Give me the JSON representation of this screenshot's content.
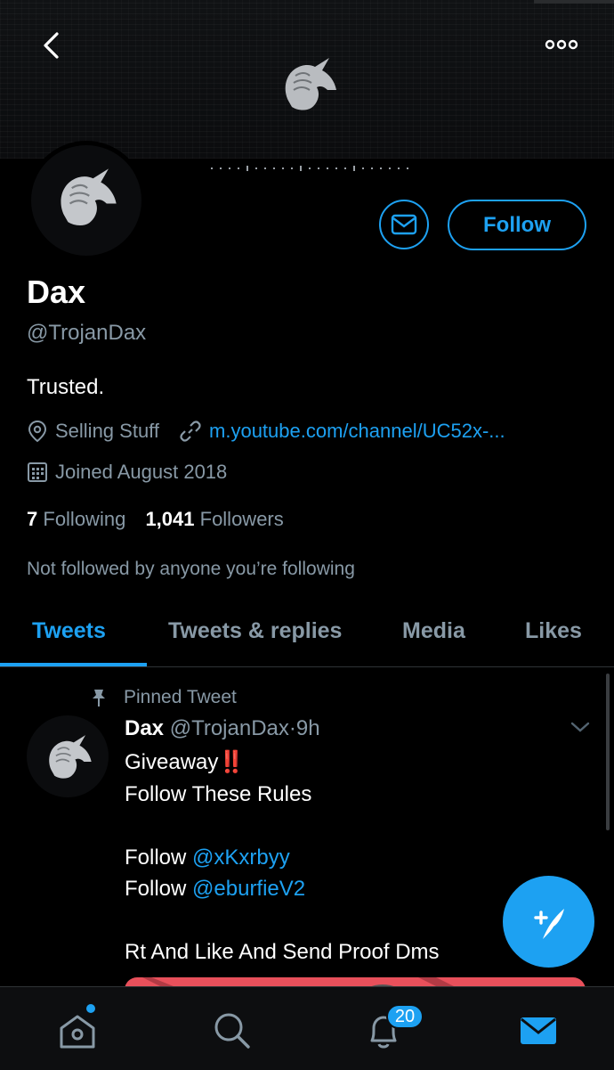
{
  "colors": {
    "accent": "#1da1f2",
    "muted": "#8899a6",
    "background": "#000000",
    "emphasis": "#e0245e"
  },
  "profile": {
    "name": "Dax",
    "handle": "@TrojanDax",
    "bio": "Trusted.",
    "location": "Selling Stuff",
    "website": "m.youtube.com/channel/UC52x-...",
    "joined": "Joined August 2018",
    "following_count": "7",
    "following_label": "Following",
    "followers_count": "1,041",
    "followers_label": "Followers",
    "not_followed": "Not followed by anyone you’re following",
    "follow_label": "Follow"
  },
  "tabs": [
    {
      "label": "Tweets",
      "active": true
    },
    {
      "label": "Tweets & replies",
      "active": false
    },
    {
      "label": "Media",
      "active": false
    },
    {
      "label": "Likes",
      "active": false
    }
  ],
  "tweet": {
    "pinned_label": "Pinned Tweet",
    "author": "Dax",
    "handle": "@TrojanDax",
    "separator": "·",
    "time": "9h",
    "line1": "Giveaway",
    "line1_emoji": "‼️",
    "line2": "Follow These Rules",
    "line3_prefix": "Follow",
    "line3_mention": "@xKxrbyy",
    "line4_prefix": "Follow",
    "line4_mention": "@eburfieV2",
    "line5": "Rt And Like And Send Proof Dms"
  },
  "nav": {
    "home_icon": "home-icon",
    "search_icon": "search-icon",
    "notifications_icon": "bell-icon",
    "notifications_badge": "20",
    "messages_icon": "envelope-icon"
  }
}
